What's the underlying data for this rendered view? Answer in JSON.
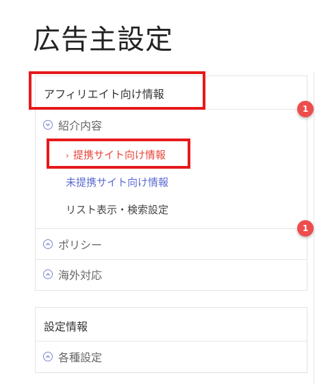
{
  "page": {
    "title": "広告主設定"
  },
  "affiliate_card": {
    "header": "アフィリエイト向け情報",
    "sections": [
      {
        "label": "紹介内容",
        "icon": "chevron-down-icon",
        "expanded": true
      },
      {
        "label": "ポリシー",
        "icon": "chevron-up-icon",
        "expanded": false
      },
      {
        "label": "海外対応",
        "icon": "chevron-up-icon",
        "expanded": false
      }
    ],
    "sub_items": [
      {
        "label": "提携サイト向け情報",
        "active": true
      },
      {
        "label": "未提携サイト向け情報",
        "active": false
      },
      {
        "label": "リスト表示・検索設定",
        "active": false
      }
    ]
  },
  "settings_card": {
    "header": "設定情報",
    "sections": [
      {
        "label": "各種設定",
        "icon": "chevron-up-icon"
      }
    ]
  },
  "badges": [
    "1",
    "1"
  ],
  "colors": {
    "accent_red": "#e8473b",
    "link_blue": "#5b6ad0",
    "icon_indigo": "#7b84c6",
    "highlight_red": "#e61919",
    "badge_red": "#ee4d4d"
  }
}
